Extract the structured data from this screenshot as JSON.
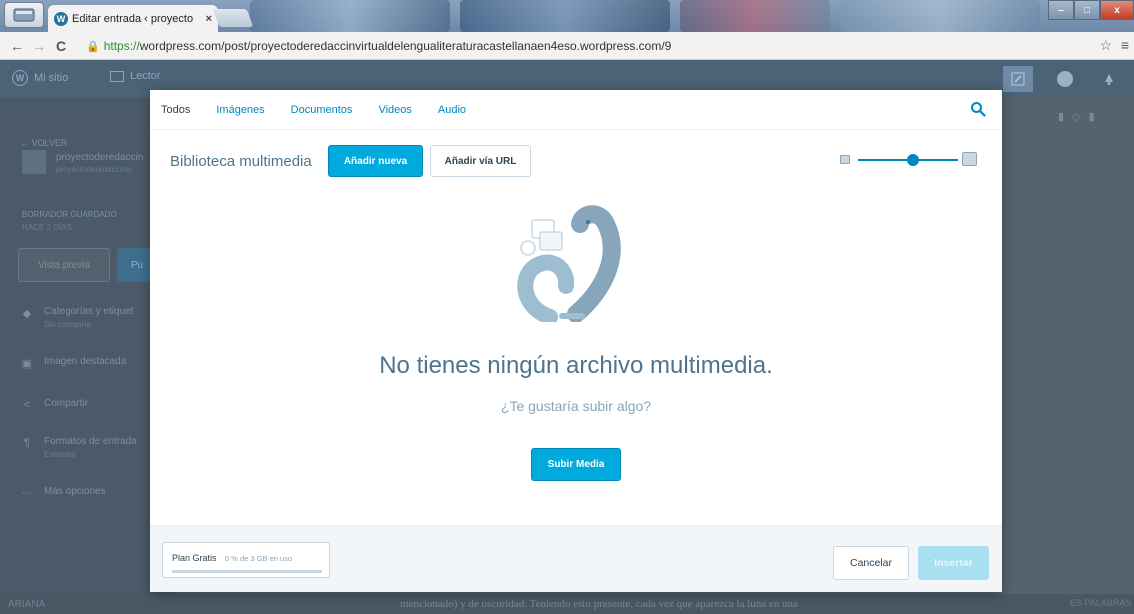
{
  "browser": {
    "tab_title": "Editar entrada ‹ proyecto",
    "tab_close": "×",
    "url_scheme": "https://",
    "url_rest": "wordpress.com/post/proyectoderedaccinvirtualdelengualiteraturacastellanaen4eso.wordpress.com/9",
    "nav_back": "←",
    "nav_forward": "→",
    "reload": "C",
    "star": "☆",
    "menu": "≡",
    "win_min": "–",
    "win_max": "□",
    "win_close": "x"
  },
  "masterbar": {
    "my_site": "Mi sitio",
    "reader": "Lector"
  },
  "background": {
    "back": "← VOLVER",
    "site_name": "proyectoderedaccin",
    "site_url": "proyectoderedaccinvi",
    "draft_status": "BORRADOR GUARDADO",
    "draft_time": "HACE 2 DÍAS",
    "preview": "Vista previa",
    "publish": "Pu",
    "categories": "Categorías y etiquet",
    "categories_sub": "Sin categoría",
    "featured_image": "Imagen destacada",
    "share": "Compartir",
    "formats": "Formatos de entrada",
    "formats_sub": "Estándar",
    "more_options": "Más opciones",
    "status_left": "ARIANA",
    "status_right": "ES PALABRAS",
    "bottom_text": "mencionado) y de oscuridad. Teniendo esto presente, cada vez que aparezca la luna en una"
  },
  "media_modal": {
    "filters": [
      "Todos",
      "Imágenes",
      "Documentos",
      "Videos",
      "Audio"
    ],
    "active_filter": "Todos",
    "library_title": "Biblioteca multimedia",
    "add_new": "Añadir nueva",
    "add_via_url": "Añadir vía URL",
    "zoom_level": 0.55,
    "empty_title": "No tienes ningún archivo multimedia.",
    "empty_subtitle": "¿Te gustaría subir algo?",
    "upload_button": "Subir Media",
    "plan_name": "Plan Gratis",
    "plan_usage": "0 % de 3 GB en uso",
    "plan_usage_fraction": 0.0,
    "cancel": "Cancelar",
    "insert": "Insertar"
  },
  "colors": {
    "accent": "#00aadc",
    "link": "#0087be",
    "text": "#2e4453",
    "muted": "#87a6bc"
  }
}
